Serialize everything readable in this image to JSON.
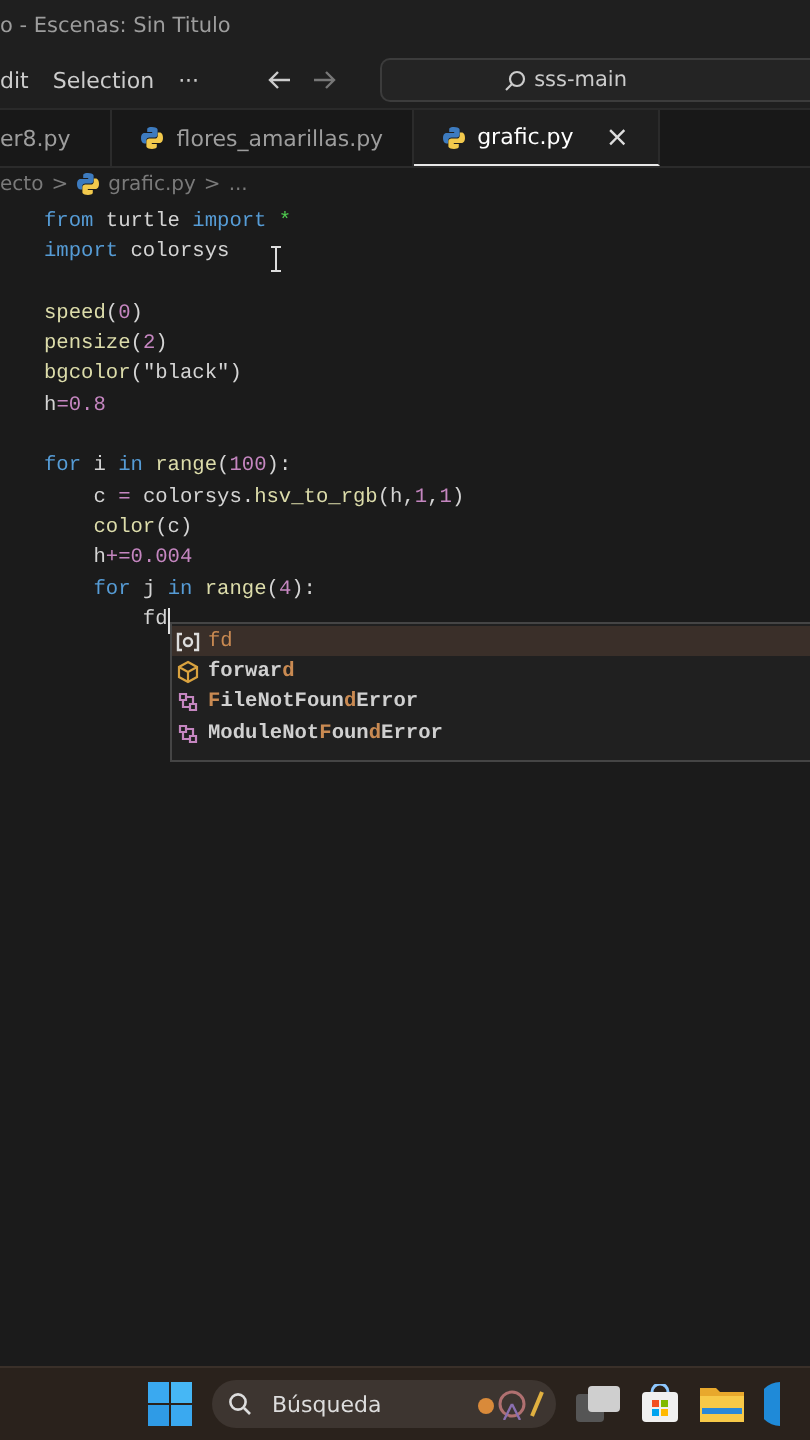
{
  "window": {
    "title": "o - Escenas: Sin Titulo"
  },
  "menu": [
    "dit",
    "Selection",
    "···"
  ],
  "command_center": {
    "value": "sss-main"
  },
  "tabs": [
    {
      "label": "er8.py",
      "selected": false,
      "icon": false
    },
    {
      "label": "flores_amarillas.py",
      "selected": false,
      "icon": true
    },
    {
      "label": "grafic.py",
      "selected": true,
      "icon": true,
      "close": "×"
    }
  ],
  "breadcrumb": [
    "ecto",
    ">",
    "grafic.py",
    ">",
    "..."
  ],
  "code_blocks": [
    [
      [
        {
          "t": "from",
          "kind": "kw"
        },
        {
          "t": " turtle ",
          "kind": "plain"
        },
        {
          "t": "import",
          "kind": "kw"
        },
        {
          "t": " *",
          "kind": "star"
        }
      ],
      [
        {
          "t": "import",
          "kind": "kw"
        },
        {
          "t": " colorsys",
          "kind": "plain"
        }
      ]
    ],
    [
      [
        {
          "t": "speed",
          "kind": "fn"
        },
        {
          "t": "(",
          "kind": "plain"
        },
        {
          "t": "0",
          "kind": "num"
        },
        {
          "t": ")",
          "kind": "plain"
        }
      ],
      [
        {
          "t": "pensize",
          "kind": "fn"
        },
        {
          "t": "(",
          "kind": "plain"
        },
        {
          "t": "2",
          "kind": "num"
        },
        {
          "t": ")",
          "kind": "plain"
        }
      ],
      [
        {
          "t": "bgcolor",
          "kind": "fn"
        },
        {
          "t": "(\"black\")",
          "kind": "plain"
        }
      ],
      [
        {
          "t": "h",
          "kind": "plain"
        },
        {
          "t": "=",
          "kind": "op"
        },
        {
          "t": "0.8",
          "kind": "num"
        }
      ]
    ],
    [
      [
        {
          "t": "for",
          "kind": "kw"
        },
        {
          "t": " i ",
          "kind": "plain"
        },
        {
          "t": "in",
          "kind": "kw"
        },
        {
          "t": " range",
          "kind": "fn"
        },
        {
          "t": "(",
          "kind": "plain"
        },
        {
          "t": "100",
          "kind": "num"
        },
        {
          "t": "):",
          "kind": "plain"
        }
      ],
      [
        {
          "t": "    c ",
          "kind": "plain"
        },
        {
          "t": "=",
          "kind": "op"
        },
        {
          "t": " colorsys.",
          "kind": "plain"
        },
        {
          "t": "hsv_to_rgb",
          "kind": "fn"
        },
        {
          "t": "(h,",
          "kind": "plain"
        },
        {
          "t": "1",
          "kind": "num"
        },
        {
          "t": ",",
          "kind": "plain"
        },
        {
          "t": "1",
          "kind": "num"
        },
        {
          "t": ")",
          "kind": "plain"
        }
      ],
      [
        {
          "t": "    color",
          "kind": "fn"
        },
        {
          "t": "(c)",
          "kind": "plain"
        }
      ],
      [
        {
          "t": "    h",
          "kind": "plain"
        },
        {
          "t": "+=",
          "kind": "op"
        },
        {
          "t": "0.004",
          "kind": "num"
        }
      ],
      [
        {
          "t": "    for",
          "kind": "kw"
        },
        {
          "t": " j ",
          "kind": "plain"
        },
        {
          "t": "in",
          "kind": "kw"
        },
        {
          "t": " range",
          "kind": "fn"
        },
        {
          "t": "(",
          "kind": "plain"
        },
        {
          "t": "4",
          "kind": "num"
        },
        {
          "t": "):",
          "kind": "plain"
        }
      ],
      [
        {
          "t": "        fd",
          "kind": "plain"
        }
      ]
    ]
  ],
  "suggestions": [
    {
      "kind": "variable",
      "selected": true,
      "parts": [
        {
          "t": "fd",
          "match": true
        }
      ]
    },
    {
      "kind": "method",
      "selected": false,
      "parts": [
        {
          "t": "forwar",
          "match": false
        },
        {
          "t": "d",
          "match": true
        }
      ]
    },
    {
      "kind": "class",
      "selected": false,
      "parts": [
        {
          "t": "F",
          "match": true
        },
        {
          "t": "ileNotFoun",
          "match": false
        },
        {
          "t": "d",
          "match": true
        },
        {
          "t": "Error",
          "match": false
        }
      ]
    },
    {
      "kind": "class",
      "selected": false,
      "parts": [
        {
          "t": "ModuleNot",
          "match": false
        },
        {
          "t": "F",
          "match": true
        },
        {
          "t": "oun",
          "match": false
        },
        {
          "t": "d",
          "match": true
        },
        {
          "t": "Error",
          "match": false
        }
      ]
    }
  ],
  "taskbar": {
    "search_placeholder": "Búsqueda"
  }
}
